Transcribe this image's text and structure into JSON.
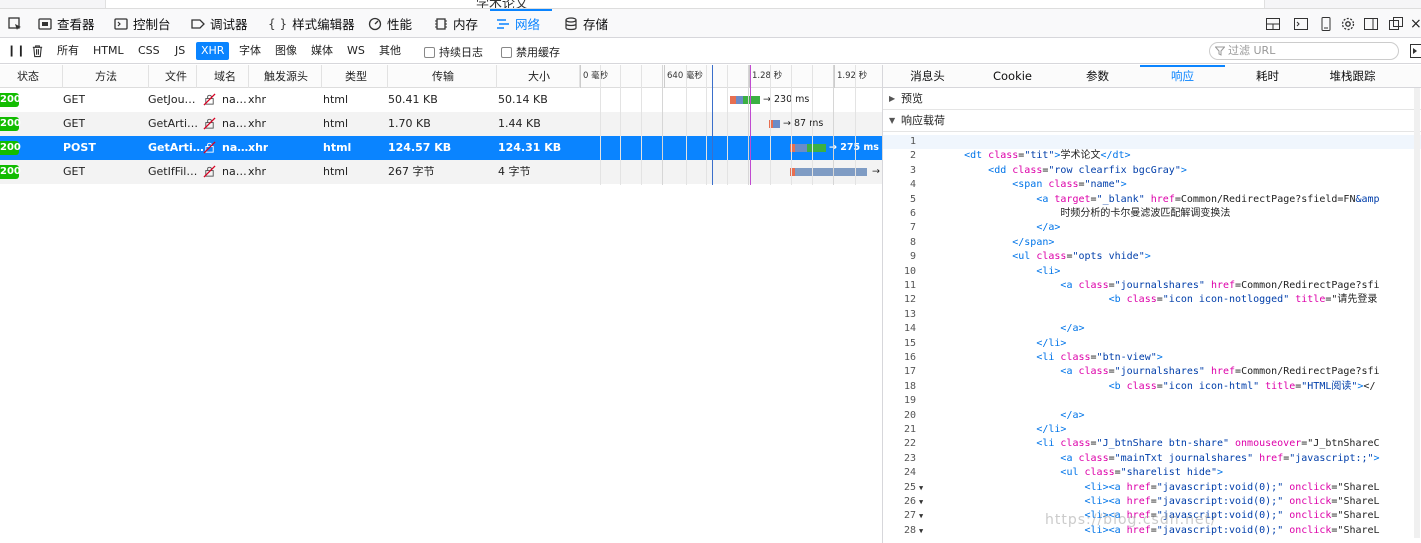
{
  "page_title_fragment": "学术论文",
  "toolbar": {
    "tabs": [
      {
        "label": "查看器",
        "icon": "inspector-icon"
      },
      {
        "label": "控制台",
        "icon": "console-icon"
      },
      {
        "label": "调试器",
        "icon": "debugger-icon"
      },
      {
        "label": "样式编辑器",
        "icon": "style-editor-icon"
      },
      {
        "label": "性能",
        "icon": "performance-icon"
      },
      {
        "label": "内存",
        "icon": "memory-icon"
      },
      {
        "label": "网络",
        "icon": "network-icon"
      },
      {
        "label": "存储",
        "icon": "storage-icon"
      }
    ],
    "active_tab": "网络"
  },
  "filter": {
    "types": [
      "所有",
      "HTML",
      "CSS",
      "JS",
      "XHR",
      "字体",
      "图像",
      "媒体",
      "WS",
      "其他"
    ],
    "active_type": "XHR",
    "persist_log": "持续日志",
    "disable_cache": "禁用缓存",
    "url_placeholder": "过滤 URL"
  },
  "columns": {
    "status": "状态",
    "method": "方法",
    "file": "文件",
    "domain": "域名",
    "cause": "触发源头",
    "type": "类型",
    "transferred": "传输",
    "size": "大小",
    "ticks": [
      "0 毫秒",
      "640 毫秒",
      "1.28 秒",
      "1.92 秒"
    ]
  },
  "requests": [
    {
      "status": "200",
      "method": "GET",
      "file": "GetJou…",
      "domain": "na…",
      "cause": "xhr",
      "type": "html",
      "transferred": "50.41 KB",
      "size": "50.14 KB",
      "timing": "→ 230 ms"
    },
    {
      "status": "200",
      "method": "GET",
      "file": "GetArti…",
      "domain": "na…",
      "cause": "xhr",
      "type": "html",
      "transferred": "1.70 KB",
      "size": "1.44 KB",
      "timing": "→ 87 ms"
    },
    {
      "status": "200",
      "method": "POST",
      "file": "GetArti…",
      "domain": "na…",
      "cause": "xhr",
      "type": "html",
      "transferred": "124.57 KB",
      "size": "124.31 KB",
      "timing": "→ 275 ms"
    },
    {
      "status": "200",
      "method": "GET",
      "file": "GetIfFil…",
      "domain": "na…",
      "cause": "xhr",
      "type": "html",
      "transferred": "267 字节",
      "size": "4 字节",
      "timing": "→"
    }
  ],
  "details": {
    "tabs": [
      "消息头",
      "Cookie",
      "参数",
      "响应",
      "耗时",
      "堆栈跟踪"
    ],
    "active_tab": "响应",
    "preview": "预览",
    "payload": "响应载荷"
  },
  "code_lines": [
    "",
    "    <dt class=\"tit\">学术论文</dt>",
    "        <dd class=\"row clearfix bgcGray\">",
    "            <span class=\"name\">",
    "                <a target=\"_blank\" href=Common/RedirectPage?sfield=FN&amp",
    "                    时频分析的卡尔曼滤波匹配解调变换法",
    "                </a>",
    "            </span>",
    "            <ul class=\"opts vhide\">",
    "                <li>",
    "                    <a class=\"journalshares\" href=Common/RedirectPage?sfi",
    "                            <b class=\"icon icon-notlogged\" title=\"请先登录",
    "",
    "                    </a>",
    "                </li>",
    "                <li class=\"btn-view\">",
    "                    <a class=\"journalshares\" href=Common/RedirectPage?sfi",
    "                            <b class=\"icon icon-html\" title=\"HTML阅读\"></",
    "",
    "                    </a>",
    "                </li>",
    "                <li class=\"J_btnShare btn-share\" onmouseover=\"J_btnShareC",
    "                    <a class=\"mainTxt journalshares\" href=\"javascript:;\">",
    "                    <ul class=\"sharelist hide\">",
    "                        <li><a href=\"javascript:void(0);\" onclick=\"ShareL",
    "                        <li><a href=\"javascript:void(0);\" onclick=\"ShareL",
    "                        <li><a href=\"javascript:void(0);\" onclick=\"ShareL",
    "                        <li><a href=\"javascript:void(0);\" onclick=\"ShareL"
  ],
  "fold_lines": [
    25,
    26,
    27,
    28
  ],
  "watermark": "https://blog.csdn.net/",
  "colors": {
    "accent": "#0a84ff",
    "status_ok": "#12bc00",
    "selected_row": "#0a84ff"
  }
}
